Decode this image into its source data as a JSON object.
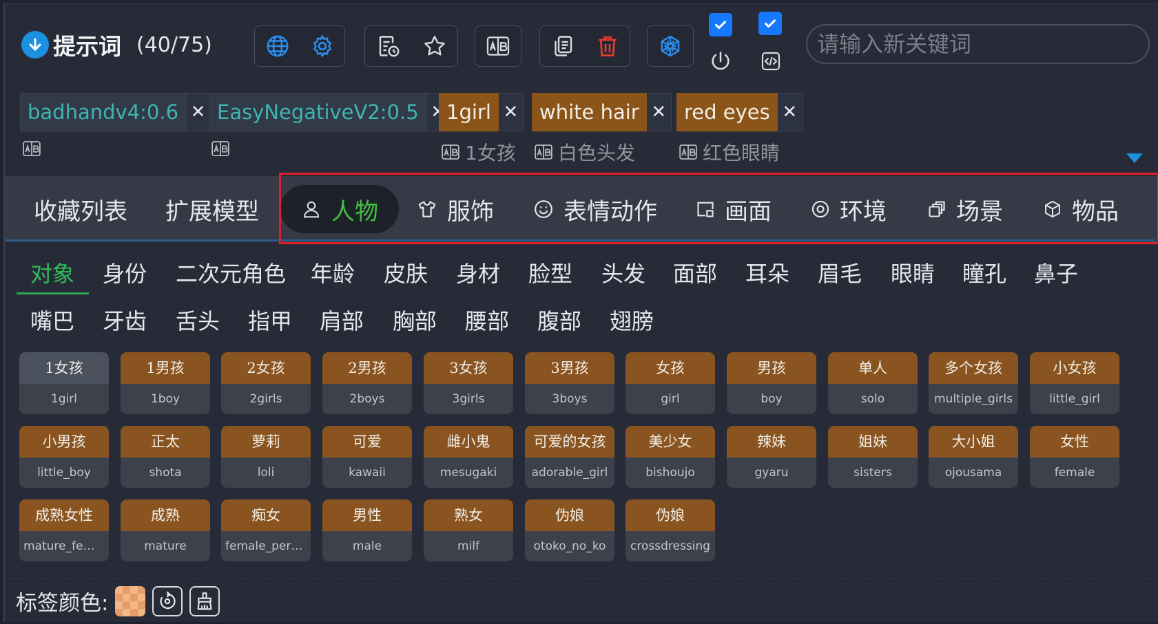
{
  "header": {
    "title": "提示词",
    "count": "(40/75)",
    "search_placeholder": "请输入新关键词"
  },
  "prompt_tags": [
    {
      "text": "badhandv4:0.6",
      "kind": "negative",
      "translation": ""
    },
    {
      "text": "EasyNegativeV2:0.5",
      "kind": "negative",
      "translation": ""
    },
    {
      "text": "1girl",
      "kind": "positive",
      "translation": "1女孩"
    },
    {
      "text": "white hair",
      "kind": "positive",
      "translation": "白色头发"
    },
    {
      "text": "red eyes",
      "kind": "positive",
      "translation": "红色眼睛"
    }
  ],
  "main_tabs": [
    {
      "label": "收藏列表"
    },
    {
      "label": "扩展模型"
    },
    {
      "label": "人物",
      "icon": "person-icon",
      "active": true
    },
    {
      "label": "服饰",
      "icon": "shirt-icon"
    },
    {
      "label": "表情动作",
      "icon": "smile-icon"
    },
    {
      "label": "画面",
      "icon": "frame-icon"
    },
    {
      "label": "环境",
      "icon": "target-icon"
    },
    {
      "label": "场景",
      "icon": "layers-icon"
    },
    {
      "label": "物品",
      "icon": "cube-icon"
    }
  ],
  "sub_tabs": [
    "对象",
    "身份",
    "二次元角色",
    "年龄",
    "皮肤",
    "身材",
    "脸型",
    "头发",
    "面部",
    "耳朵",
    "眉毛",
    "眼睛",
    "瞳孔",
    "鼻子",
    "嘴巴",
    "牙齿",
    "舌头",
    "指甲",
    "肩部",
    "胸部",
    "腰部",
    "腹部",
    "翅膀"
  ],
  "cards": [
    {
      "cn": "1女孩",
      "en": "1girl",
      "selected": true
    },
    {
      "cn": "1男孩",
      "en": "1boy"
    },
    {
      "cn": "2女孩",
      "en": "2girls"
    },
    {
      "cn": "2男孩",
      "en": "2boys"
    },
    {
      "cn": "3女孩",
      "en": "3girls"
    },
    {
      "cn": "3男孩",
      "en": "3boys"
    },
    {
      "cn": "女孩",
      "en": "girl"
    },
    {
      "cn": "男孩",
      "en": "boy"
    },
    {
      "cn": "单人",
      "en": "solo"
    },
    {
      "cn": "多个女孩",
      "en": "multiple_girls"
    },
    {
      "cn": "小女孩",
      "en": "little_girl"
    },
    {
      "cn": "小男孩",
      "en": "little_boy"
    },
    {
      "cn": "正太",
      "en": "shota"
    },
    {
      "cn": "萝莉",
      "en": "loli"
    },
    {
      "cn": "可爱",
      "en": "kawaii"
    },
    {
      "cn": "雌小鬼",
      "en": "mesugaki"
    },
    {
      "cn": "可爱的女孩",
      "en": "adorable_girl"
    },
    {
      "cn": "美少女",
      "en": "bishoujo"
    },
    {
      "cn": "辣妹",
      "en": "gyaru"
    },
    {
      "cn": "姐妹",
      "en": "sisters"
    },
    {
      "cn": "大小姐",
      "en": "ojousama"
    },
    {
      "cn": "女性",
      "en": "female"
    },
    {
      "cn": "成熟女性",
      "en": "mature_fem..."
    },
    {
      "cn": "成熟",
      "en": "mature"
    },
    {
      "cn": "痴女",
      "en": "female_perv..."
    },
    {
      "cn": "男性",
      "en": "male"
    },
    {
      "cn": "熟女",
      "en": "milf"
    },
    {
      "cn": "伪娘",
      "en": "otoko_no_ko"
    },
    {
      "cn": "伪娘",
      "en": "crossdressing"
    }
  ],
  "footer": {
    "label": "标签颜色:"
  },
  "colors": {
    "accent": "#1d8fe0",
    "tag_bg": "#8b5418",
    "active_green": "#42c142",
    "delete_red": "#e63b2e"
  }
}
